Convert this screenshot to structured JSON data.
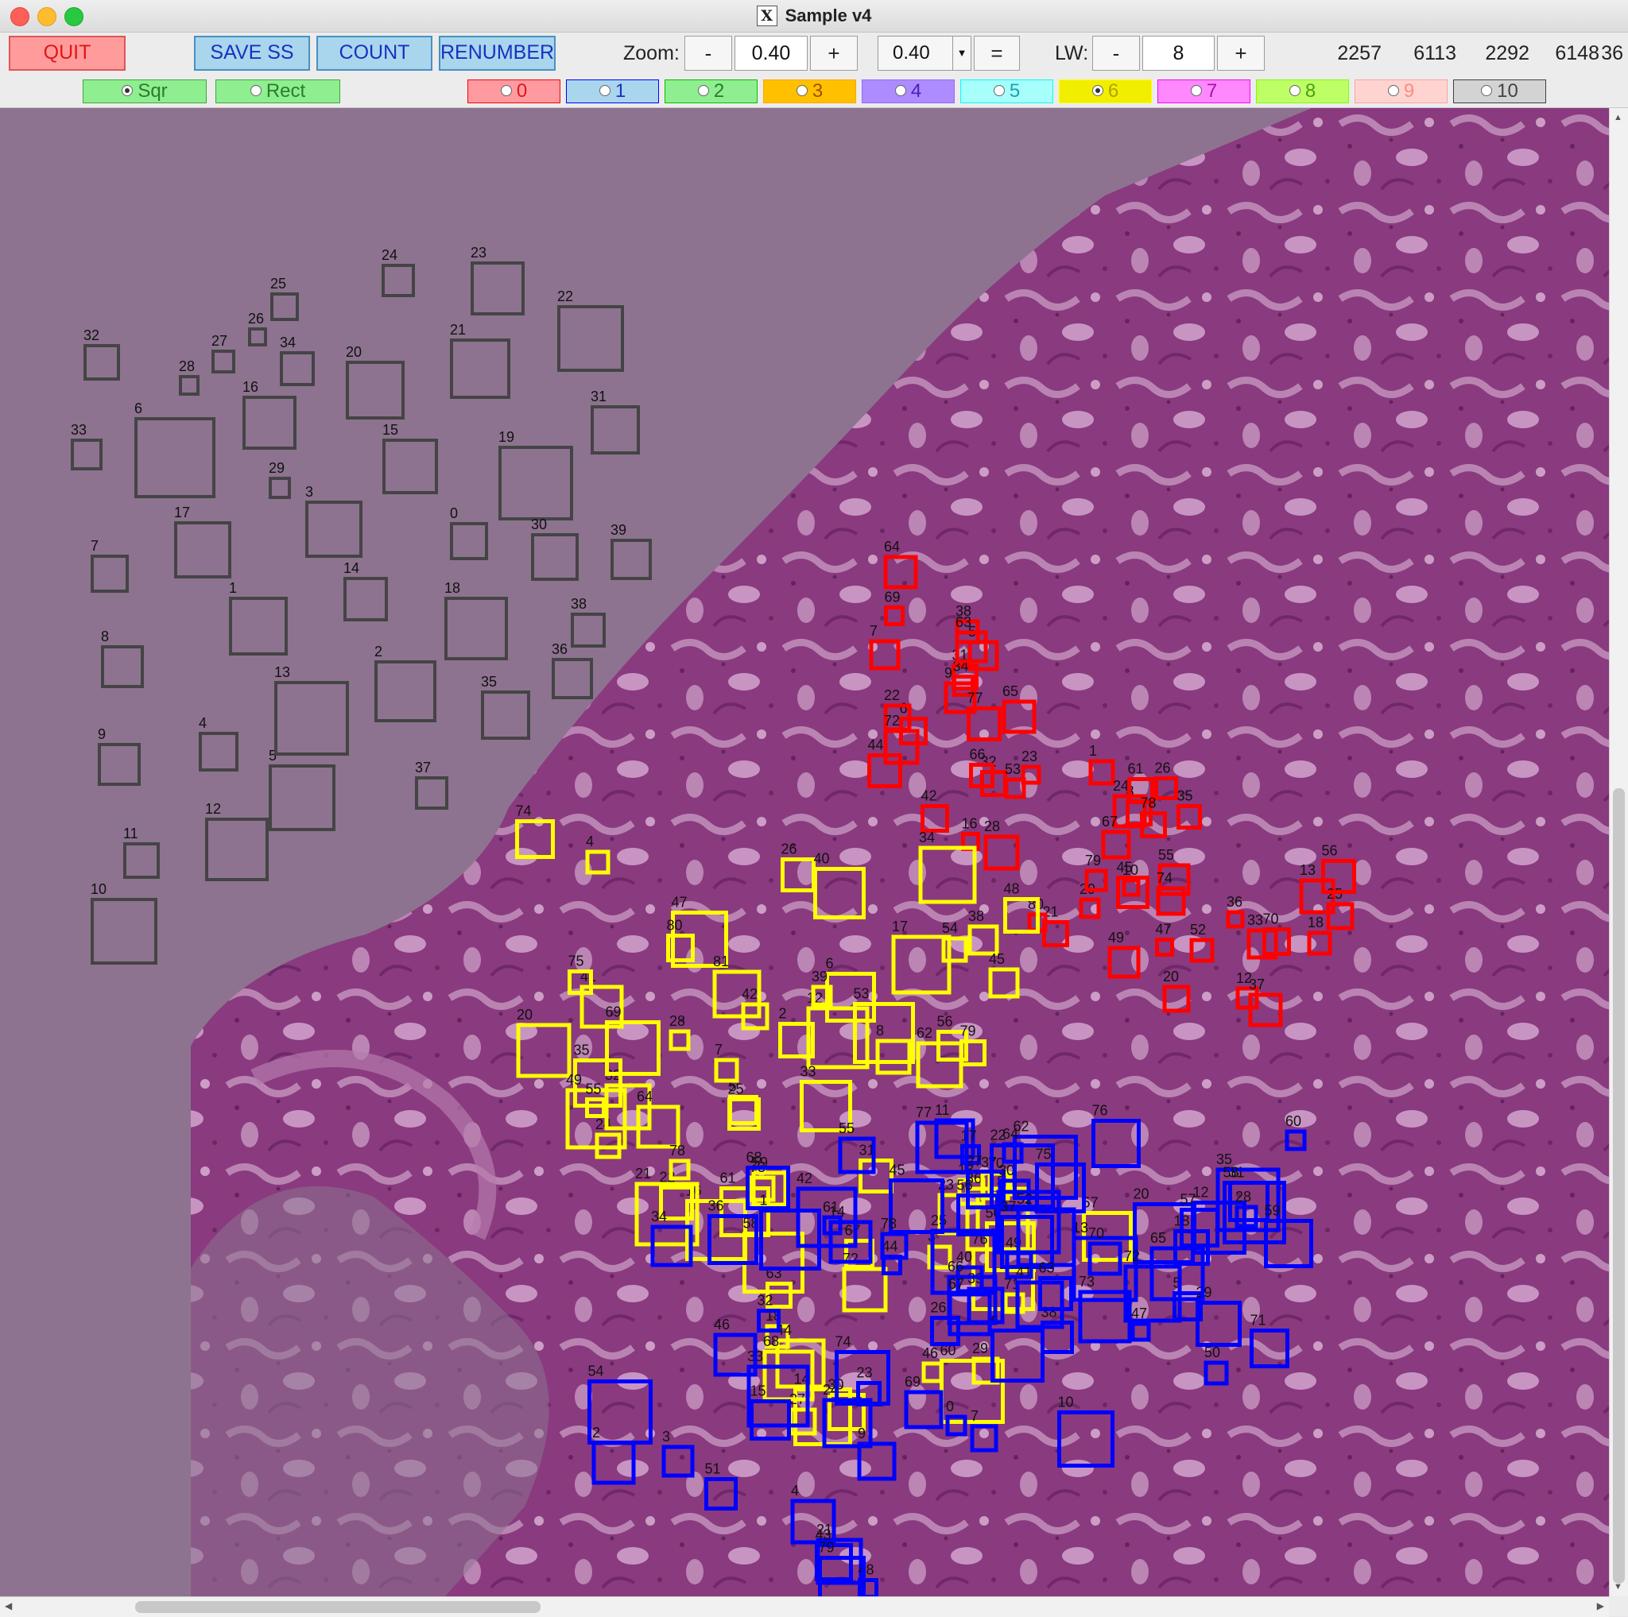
{
  "window": {
    "title": "Sample v4"
  },
  "toolbar": {
    "quit": "QUIT",
    "save": "SAVE SS",
    "count": "COUNT",
    "renumber": "RENUMBER",
    "zoom_label": "Zoom:",
    "minus": "-",
    "plus": "+",
    "zoom_value": "0.40",
    "zoom_combo": "0.40",
    "equals": "=",
    "lw_label": "LW:",
    "lw_value": "8",
    "coords": [
      "2257",
      "6113",
      "2292",
      "6148",
      "36"
    ]
  },
  "shape_mode": [
    {
      "label": "Sqr",
      "selected": true
    },
    {
      "label": "Rect",
      "selected": false
    }
  ],
  "classes": [
    {
      "label": "0",
      "color": "#ff0000",
      "bg": "#ff9aa0",
      "fg": "#e21616",
      "selected": false
    },
    {
      "label": "1",
      "color": "#0000ff",
      "bg": "#a9d6ec",
      "fg": "#1a30c2",
      "selected": false
    },
    {
      "label": "2",
      "color": "#00c000",
      "bg": "#8fee8f",
      "fg": "#2a7d2a",
      "selected": false
    },
    {
      "label": "3",
      "color": "#ffa500",
      "bg": "#ffc000",
      "fg": "#a05000",
      "selected": false
    },
    {
      "label": "4",
      "color": "#9966ff",
      "bg": "#ad8cff",
      "fg": "#4a21b5",
      "selected": false
    },
    {
      "label": "5",
      "color": "#00ffff",
      "bg": "#a6fffa",
      "fg": "#1aa2b2",
      "selected": false
    },
    {
      "label": "6",
      "color": "#ffff00",
      "bg": "#f2ee00",
      "fg": "#b8a000",
      "selected": true
    },
    {
      "label": "7",
      "color": "#ff00ff",
      "bg": "#ff88ff",
      "fg": "#a0159e",
      "selected": false
    },
    {
      "label": "8",
      "color": "#80ff00",
      "bg": "#beff66",
      "fg": "#4d9e14",
      "selected": false
    },
    {
      "label": "9",
      "color": "#ffa0a0",
      "bg": "#ffd4d0",
      "fg": "#ff8a80",
      "selected": false
    },
    {
      "label": "10",
      "color": "#404040",
      "bg": "#d3d3d3",
      "fg": "#444444",
      "selected": false
    }
  ],
  "annotations": {
    "dark": {
      "color": "#444444",
      "labels": [
        "0",
        "1",
        "2",
        "3",
        "4",
        "5",
        "6",
        "7",
        "8",
        "9",
        "10",
        "11",
        "12",
        "13",
        "14",
        "15",
        "16",
        "17",
        "18",
        "19",
        "20",
        "21",
        "22",
        "23",
        "24",
        "25",
        "26",
        "27",
        "28",
        "29",
        "30",
        "31",
        "32",
        "33",
        "34",
        "35",
        "36",
        "37",
        "38",
        "39"
      ]
    },
    "red": {
      "color": "#ff0000",
      "labels": [
        "1",
        "5",
        "6",
        "7",
        "8",
        "9",
        "10",
        "12",
        "13",
        "16",
        "18",
        "20",
        "21",
        "22",
        "23",
        "24",
        "25",
        "26",
        "28",
        "29",
        "31",
        "32",
        "33",
        "34",
        "35",
        "36",
        "37",
        "38",
        "42",
        "44",
        "45",
        "47",
        "49",
        "52",
        "53",
        "55",
        "56",
        "61",
        "63",
        "64",
        "65",
        "66",
        "67",
        "69",
        "70",
        "72",
        "74",
        "77",
        "78",
        "79",
        "80"
      ]
    },
    "yellow": {
      "color": "#ffff00",
      "labels": [
        "2",
        "3",
        "4",
        "5",
        "6",
        "7",
        "8",
        "12",
        "13",
        "14",
        "16",
        "17",
        "18",
        "20",
        "21",
        "22",
        "23",
        "24",
        "25",
        "26",
        "27",
        "28",
        "29",
        "30",
        "31",
        "32",
        "33",
        "34",
        "35",
        "36",
        "37",
        "38",
        "39",
        "40",
        "41",
        "42",
        "44",
        "45",
        "46",
        "47",
        "48",
        "49",
        "50",
        "53",
        "54",
        "55",
        "56",
        "57",
        "58",
        "59",
        "60",
        "61",
        "62",
        "63",
        "64",
        "67",
        "68",
        "69",
        "70",
        "71",
        "72",
        "73",
        "74",
        "75",
        "76",
        "78",
        "79",
        "80",
        "81"
      ]
    },
    "blue": {
      "color": "#0000ff",
      "labels": [
        "0",
        "1",
        "2",
        "3",
        "4",
        "5",
        "6",
        "7",
        "8",
        "9",
        "10",
        "11",
        "12",
        "13",
        "14",
        "15",
        "17",
        "18",
        "20",
        "21",
        "22",
        "23",
        "24",
        "25",
        "26",
        "27",
        "28",
        "29",
        "30",
        "31",
        "32",
        "33",
        "34",
        "35",
        "36",
        "37",
        "38",
        "39",
        "40",
        "41",
        "42",
        "43",
        "44",
        "45",
        "46",
        "47",
        "48",
        "49",
        "50",
        "51",
        "52",
        "54",
        "55",
        "56",
        "57",
        "58",
        "59",
        "60",
        "61",
        "62",
        "63",
        "64",
        "65",
        "66",
        "67",
        "68",
        "69",
        "70",
        "71",
        "72",
        "73",
        "74",
        "75",
        "76",
        "77",
        "78",
        "79"
      ]
    }
  }
}
